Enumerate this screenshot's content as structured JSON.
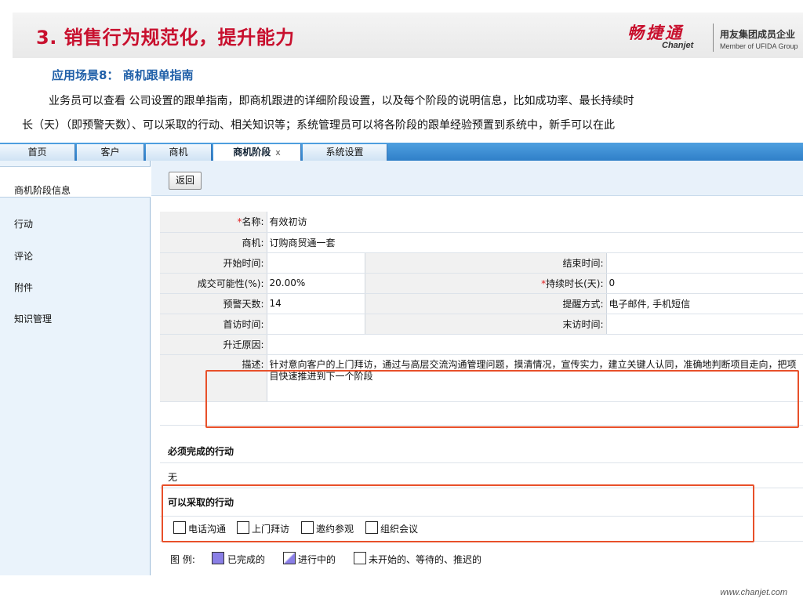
{
  "slide": {
    "title": "3. 销售行为规范化，提升能力",
    "logo_cn": "畅捷通",
    "logo_en": "Chanjet",
    "logo_group_cn": "用友集团成员企业",
    "logo_group_en": "Member of UFIDA Group",
    "scene_title": "应用场景8： 商机跟单指南",
    "paragraph_line1": "业务员可以查看 公司设置的跟单指南，即商机跟进的详细阶段设置，以及每个阶段的说明信息，比如成功率、最长持续时",
    "paragraph_line2": "长（天）（即预警天数）、可以采取的行动、相关知识等；系统管理员可以将各阶段的跟单经验预置到系统中，新手可以在此",
    "footer_url": "www.chanjet.com"
  },
  "tabs": [
    {
      "label": "首页"
    },
    {
      "label": "客户"
    },
    {
      "label": "商机"
    },
    {
      "label": "商机阶段",
      "close": "x"
    },
    {
      "label": "系统设置"
    }
  ],
  "sidebar": {
    "header": "商机阶段信息",
    "items": [
      "行动",
      "评论",
      "附件",
      "知识管理"
    ]
  },
  "toolbar": {
    "back_label": "返回"
  },
  "form": {
    "name_label": "名称:",
    "name_value": "有效初访",
    "opportunity_label": "商机:",
    "opportunity_value": "订购商贸通一套",
    "start_label": "开始时间:",
    "end_label": "结束时间:",
    "probability_label": "成交可能性(%):",
    "probability_value": "20.00%",
    "duration_label": "持续时长(天):",
    "duration_value": "0",
    "warning_label": "预警天数:",
    "warning_value": "14",
    "remind_label": "提醒方式:",
    "remind_value": "电子邮件, 手机短信",
    "first_visit_label": "首访时间:",
    "last_visit_label": "末访时间:",
    "reason_label": "升迁原因:",
    "desc_label": "描述:",
    "desc_value": "针对意向客户的上门拜访，通过与高层交流沟通管理问题，摸清情况，宣传实力，建立关键人认同，准确地判断项目走向，把项目快速推进到下一个阶段"
  },
  "required_actions": {
    "title": "必须完成的行动",
    "value": "无"
  },
  "optional_actions": {
    "title": "可以采取的行动",
    "items": [
      "电话沟通",
      "上门拜访",
      "邀约参观",
      "组织会议"
    ]
  },
  "legend": {
    "label": "图 例:",
    "completed": "已完成的",
    "in_progress": "进行中的",
    "not_started": "未开始的、等待的、推迟的",
    "completed_color": "#8a7fe6",
    "in_progress_color": "#8a7fe6"
  },
  "colors": {
    "accent_red": "#c8102e",
    "scene_blue": "#1f5fa8",
    "highlight": "#e8502a"
  }
}
